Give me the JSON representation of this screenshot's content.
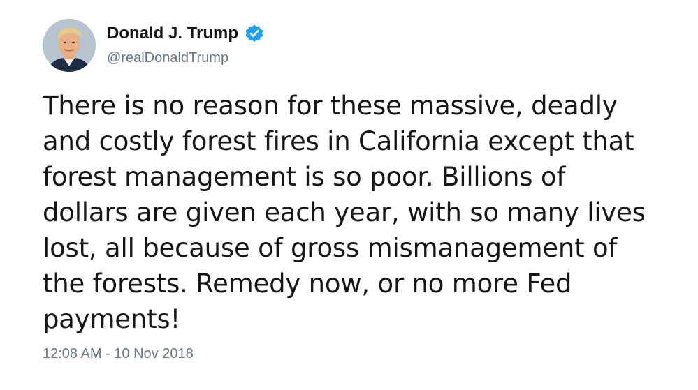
{
  "author": {
    "display_name": "Donald J. Trump",
    "handle": "@realDonaldTrump",
    "verified": true,
    "avatar_icon": "profile-photo",
    "verified_icon": "verified-badge-icon"
  },
  "tweet": {
    "lines": [
      "There is no reason for these massive, deadly",
      "and costly forest fires in California except that",
      "forest management is so poor. Billions of",
      "dollars are given each year, with so many lives",
      "lost, all because of gross mismanagement of",
      "the forests. Remedy now, or no more Fed",
      "payments!"
    ],
    "timestamp": "12:08 AM - 10 Nov 2018"
  },
  "colors": {
    "text": "#14171a",
    "secondary": "#657786",
    "verified_blue": "#1da1f2"
  }
}
